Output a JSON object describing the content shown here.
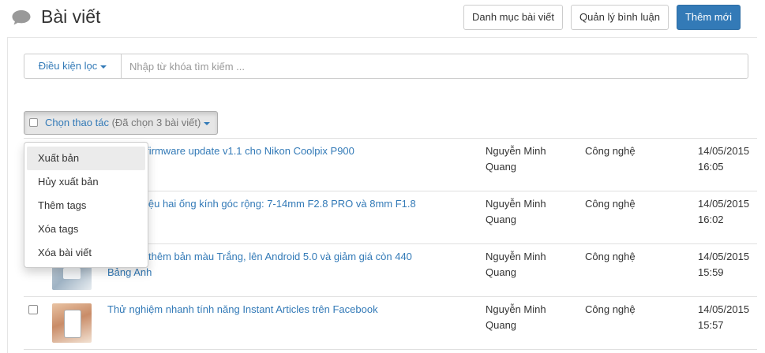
{
  "header": {
    "title": "Bài viết",
    "icon": "speech-bubble-icon",
    "buttons": {
      "categories": "Danh mục bài viết",
      "comments": "Quản lý bình luận",
      "add_new": "Thêm mới"
    },
    "colors": {
      "primary": "#337ab7",
      "link": "#337ab7"
    }
  },
  "filter": {
    "label": "Điều kiện lọc",
    "search_placeholder": "Nhập từ khóa tìm kiếm ..."
  },
  "bulk": {
    "label": "Chọn thao tác",
    "selected_text": "(Đã chọn 3 bài viết)"
  },
  "menu": {
    "items": [
      "Xuất bản",
      "Hủy xuất bản",
      "Thêm tags",
      "Xóa tags",
      "Xóa bài viết"
    ],
    "highlighted": 0
  },
  "rows": [
    {
      "title": "Chính thức phát hành bản cập nhật: Phát hành bổ firmware update v1.1 cho Nikon Coolpix P900",
      "title_visible": "…ng bổ firmware update v1.1 cho Nikon Coolpix P900",
      "author_1": "Nguyễn Minh",
      "author_2": "Quang",
      "category": "Công nghệ",
      "date": "14/05/2015",
      "time": "16:05"
    },
    {
      "title_line1": "…giới thiệu hai ống kính góc rộng: 7-14mm F2.8 PRO và 8mm F1.8",
      "title_line2": "…PRO",
      "author_1": "Nguyễn Minh",
      "author_2": "Quang",
      "category": "Công nghệ",
      "date": "14/05/2015",
      "time": "16:02"
    },
    {
      "title_line1": "…e 2 có thêm bản màu Trắng, lên Android 5.0 và giảm giá còn 440",
      "title_line2": "Bảng Anh",
      "author_1": "Nguyễn Minh",
      "author_2": "Quang",
      "category": "Công nghệ",
      "date": "14/05/2015",
      "time": "15:59"
    },
    {
      "title_line1": "Thử nghiệm nhanh tính năng Instant Articles trên Facebook",
      "author_1": "Nguyễn Minh",
      "author_2": "Quang",
      "category": "Công nghệ",
      "date": "14/05/2015",
      "time": "15:57"
    }
  ]
}
